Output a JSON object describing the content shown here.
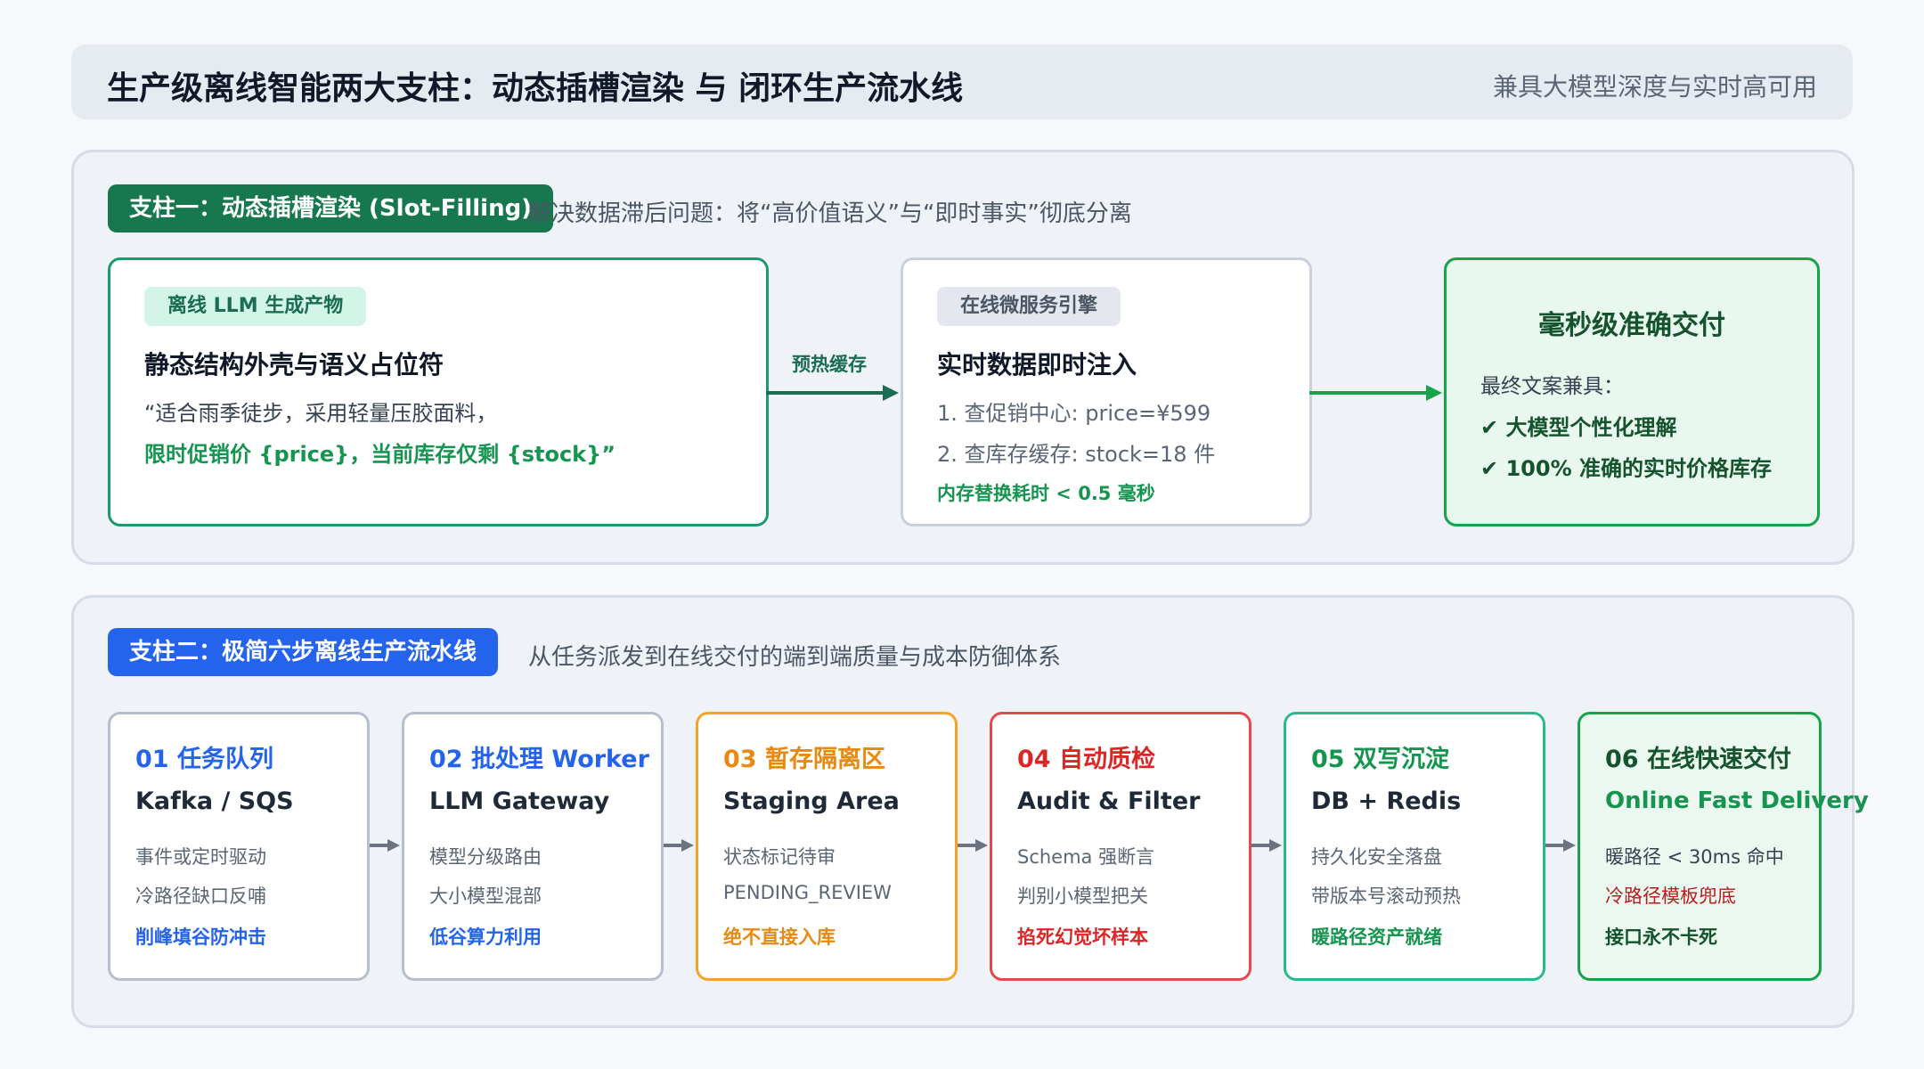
{
  "header": {
    "title": "生产级离线智能两大支柱：动态插槽渲染 与 闭环生产流水线",
    "subtitle": "兼具大模型深度与实时高可用"
  },
  "pillar1": {
    "badge": "支柱一：动态插槽渲染 (Slot-Filling)",
    "description": "解决数据滞后问题：将“高价值语义”与“即时事实”彻底分离",
    "llm_card": {
      "tag": "离线 LLM 生成产物",
      "title": "静态结构外壳与语义占位符",
      "line1": "“适合雨季徒步，采用轻量压胶面料，",
      "line2": "限时促销价 {price}，当前库存仅剩 {stock}”"
    },
    "arrow_label": "预热缓存",
    "service_card": {
      "tag": "在线微服务引擎",
      "title": "实时数据即时注入",
      "line1": "1. 查促销中心: price=¥599",
      "line2": "2. 查库存缓存: stock=18 件",
      "note": "内存替换耗时 < 0.5 毫秒"
    },
    "final_card": {
      "title": "毫秒级准确交付",
      "intro": "最终文案兼具：",
      "item1": "✔ 大模型个性化理解",
      "item2": "✔ 100% 准确的实时价格库存"
    }
  },
  "pillar2": {
    "badge": "支柱二：极简六步离线生产流水线",
    "description": "从任务派发到在线交付的端到端质量与成本防御体系",
    "steps": [
      {
        "title": "01 任务队列",
        "subtitle": "Kafka / SQS",
        "line1": "事件或定时驱动",
        "line2": "冷路径缺口反哺",
        "highlight": "削峰填谷防冲击"
      },
      {
        "title": "02 批处理 Worker",
        "subtitle": "LLM Gateway",
        "line1": "模型分级路由",
        "line2": "大小模型混部",
        "highlight": "低谷算力利用"
      },
      {
        "title": "03 暂存隔离区",
        "subtitle": "Staging Area",
        "line1": "状态标记待审",
        "line2": "PENDING_REVIEW",
        "highlight": "绝不直接入库"
      },
      {
        "title": "04 自动质检",
        "subtitle": "Audit & Filter",
        "line1": "Schema 强断言",
        "line2": "判别小模型把关",
        "highlight": "掐死幻觉坏样本"
      },
      {
        "title": "05 双写沉淀",
        "subtitle": "DB + Redis",
        "line1": "持久化安全落盘",
        "line2": "带版本号滚动预热",
        "highlight": "暖路径资产就绪"
      },
      {
        "title": "06 在线快速交付",
        "subtitle": "Online Fast Delivery",
        "line1": "暖路径 < 30ms 命中",
        "line2": "冷路径模板兜底",
        "highlight": "接口永不卡死"
      }
    ]
  },
  "colors": {
    "green_accent": "#17784f",
    "blue_accent": "#2463eb",
    "step1": "#2463eb",
    "step2": "#2463eb",
    "step3": "#e68a14",
    "step4": "#dc2626",
    "step5": "#15954f",
    "step6": "#14532d"
  }
}
